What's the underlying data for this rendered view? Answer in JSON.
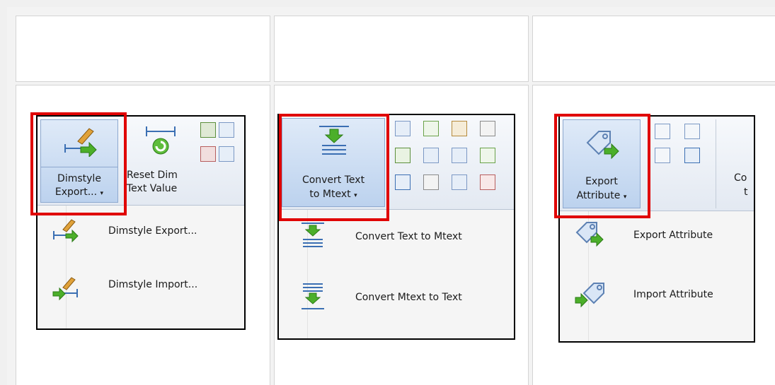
{
  "panels": {
    "dimstyle": {
      "big_button_line1": "Dimstyle",
      "big_button_line2": "Export...",
      "reset_line1": "Reset Dim",
      "reset_line2": "Text Value",
      "menu": [
        {
          "label": "Dimstyle Export...",
          "icon": "dimstyle-export-icon"
        },
        {
          "label": "Dimstyle Import...",
          "icon": "dimstyle-import-icon"
        }
      ]
    },
    "convert": {
      "big_button_line1": "Convert Text",
      "big_button_line2": "to Mtext",
      "menu": [
        {
          "label": "Convert Text to Mtext",
          "icon": "convert-text-to-mtext-icon"
        },
        {
          "label": "Convert Mtext to Text",
          "icon": "convert-mtext-to-text-icon"
        }
      ]
    },
    "attribute": {
      "big_button_line1": "Export",
      "big_button_line2": "Attribute",
      "cut_label_1": "Co",
      "cut_label_2": "t",
      "menu": [
        {
          "label": "Export Attribute",
          "icon": "export-attribute-icon"
        },
        {
          "label": "Import Attribute",
          "icon": "import-attribute-icon"
        }
      ]
    }
  },
  "dropdown_glyph": "▾",
  "colors": {
    "highlight_border": "#e00000",
    "button_blue": "#bcd2ee",
    "arrow_green": "#4caf2a"
  }
}
